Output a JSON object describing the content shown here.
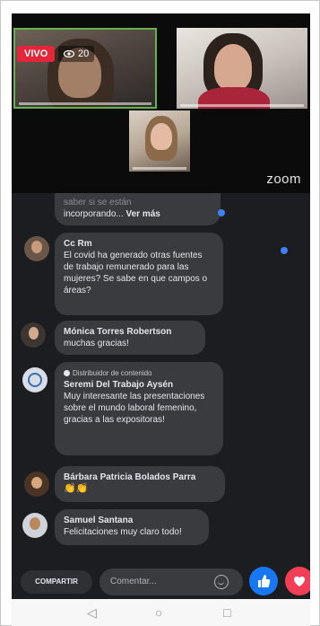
{
  "stream": {
    "live_label": "VIVO",
    "viewers": "20",
    "zoom_label": "zoom"
  },
  "comments": {
    "partial_line1": "saber si se están",
    "partial_line2": "incorporando...",
    "partial_more": "Ver más",
    "items": [
      {
        "name": "Cc Rm",
        "text": "El covid ha generado otras fuentes de trabajo remunerado para las mujeres? Se sabe en que campos o áreas?"
      },
      {
        "name": "Mónica Torres Robertson",
        "text": "muchas gracias!"
      },
      {
        "badge": "Distribuidor de contenido",
        "name": "Seremi Del Trabajo Aysén",
        "text": "Muy interesante las presentaciones sobre el mundo laboral femenino, gracias a las expositoras!"
      },
      {
        "name": "Bárbara Patricia Bolados Parra",
        "text": "👏👏"
      },
      {
        "name": "Samuel Santana",
        "text": "Felicitaciones muy claro todo!"
      }
    ]
  },
  "actions": {
    "share_label": "COMPARTIR",
    "comment_placeholder": "Comentar..."
  },
  "nav": {
    "back": "◁",
    "home": "○",
    "recents": "□"
  },
  "colors": {
    "live_red": "#e4263a",
    "like_blue": "#1877f2",
    "love_red": "#f33e58",
    "active_speaker_green": "#66b24c"
  }
}
